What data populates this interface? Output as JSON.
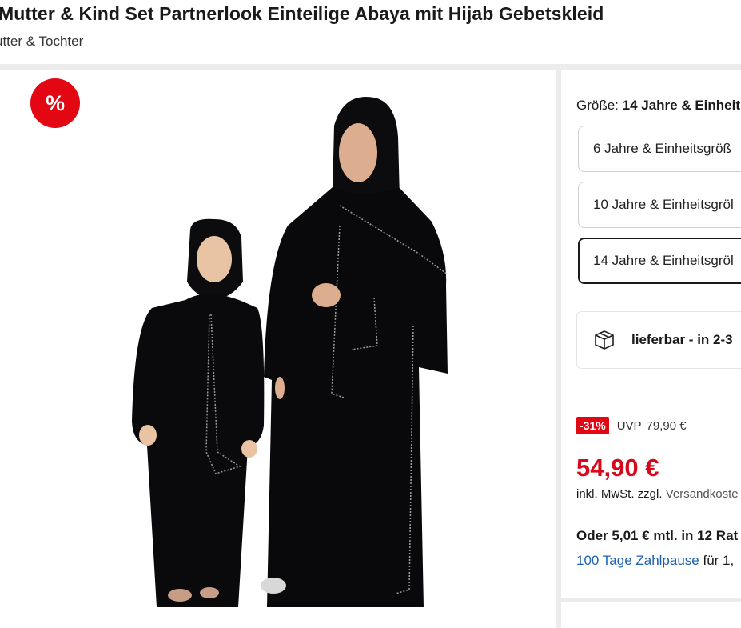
{
  "product": {
    "title": "Mutter & Kind Set Partnerlook Einteilige Abaya mit Hijab Gebetskleid",
    "subtitle": "utter & Tochter",
    "badge": "%"
  },
  "size": {
    "label": "Größe: ",
    "selected": "14 Jahre & Einheit",
    "options": [
      {
        "label": "6 Jahre & Einheitsgröß"
      },
      {
        "label": "10 Jahre & Einheitsgröl"
      },
      {
        "label": "14 Jahre & Einheitsgröl"
      }
    ]
  },
  "delivery": {
    "text": "lieferbar - in 2-3",
    "icon": "package-icon"
  },
  "pricing": {
    "discount": "-31%",
    "uvp_label": "UVP",
    "old_price": "79,90 €",
    "price": "54,90 €",
    "tax_prefix": "inkl. MwSt. zzgl. ",
    "tax_link": "Versandkoste",
    "installment": "Oder 5,01 € mtl. in 12 Rat",
    "pause_link": "100 Tage Zahlpause",
    "pause_suffix": " für 1,"
  },
  "colors": {
    "accent_red": "#e30613",
    "price_red": "#d6081a",
    "link_blue": "#1c60b3"
  }
}
